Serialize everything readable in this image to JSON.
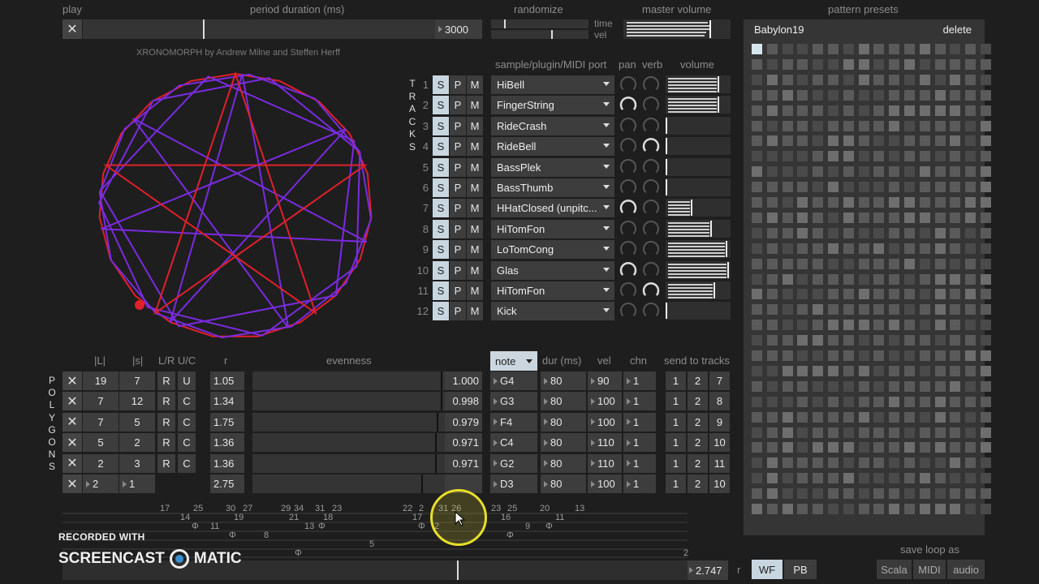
{
  "top": {
    "play_label": "play",
    "period_label": "period duration (ms)",
    "period_value": "3000",
    "period_fill": 0.34,
    "randomize_label": "randomize",
    "time_label": "time",
    "vel_label": "vel",
    "master_label": "master volume",
    "presets_label": "pattern presets"
  },
  "credit": "XRONOMORPH by Andrew Milne and Steffen Herff",
  "tracks_header": {
    "vertical": "TRACKS",
    "port": "sample/plugin/MIDI port",
    "pan": "pan",
    "verb": "verb",
    "volume": "volume"
  },
  "tracks": [
    {
      "n": "1",
      "s": "S",
      "p": "P",
      "m": "M",
      "name": "HiBell",
      "vol": 0.82
    },
    {
      "n": "2",
      "s": "S",
      "p": "P",
      "m": "M",
      "name": "FingerString",
      "vol": 0.82
    },
    {
      "n": "3",
      "s": "S",
      "p": "P",
      "m": "M",
      "name": "RideCrash",
      "vol": 0.0
    },
    {
      "n": "4",
      "s": "S",
      "p": "P",
      "m": "M",
      "name": "RideBell",
      "vol": 0.0
    },
    {
      "n": "5",
      "s": "S",
      "p": "P",
      "m": "M",
      "name": "BassPlek",
      "vol": 0.0
    },
    {
      "n": "6",
      "s": "S",
      "p": "P",
      "m": "M",
      "name": "BassThumb",
      "vol": 0.0
    },
    {
      "n": "7",
      "s": "S",
      "p": "P",
      "m": "M",
      "name": "HHatClosed (unpitc...",
      "vol": 0.4
    },
    {
      "n": "8",
      "s": "S",
      "p": "P",
      "m": "M",
      "name": "HiTomFon",
      "vol": 0.7
    },
    {
      "n": "9",
      "s": "S",
      "p": "P",
      "m": "M",
      "name": "LoTomCong",
      "vol": 0.95
    },
    {
      "n": "10",
      "s": "S",
      "p": "P",
      "m": "M",
      "name": "Glas",
      "vol": 0.98
    },
    {
      "n": "11",
      "s": "S",
      "p": "P",
      "m": "M",
      "name": "HiTomFon",
      "vol": 0.75
    },
    {
      "n": "12",
      "s": "S",
      "p": "P",
      "m": "M",
      "name": "Kick",
      "vol": 0.0
    }
  ],
  "polygons_header": {
    "vertical": "POLYGONS",
    "L": "|L|",
    "s": "|s|",
    "lr_uc": "L/R U/C",
    "r": "r",
    "evenness": "evenness",
    "note": "note",
    "dur": "dur (ms)",
    "vel": "vel",
    "chn": "chn",
    "send": "send to tracks"
  },
  "polygons": [
    {
      "L": "19",
      "s": "7",
      "lr": "R",
      "uc": "U",
      "r": "1.05",
      "even": "1.000",
      "note": "G4",
      "dur": "80",
      "vel": "90",
      "chn": "1",
      "t1": "1",
      "t2": "2",
      "t3": "7"
    },
    {
      "L": "7",
      "s": "12",
      "lr": "R",
      "uc": "C",
      "r": "1.34",
      "even": "0.998",
      "note": "G3",
      "dur": "80",
      "vel": "100",
      "chn": "1",
      "t1": "1",
      "t2": "2",
      "t3": "8"
    },
    {
      "L": "7",
      "s": "5",
      "lr": "R",
      "uc": "C",
      "r": "1.75",
      "even": "0.979",
      "note": "F4",
      "dur": "80",
      "vel": "100",
      "chn": "1",
      "t1": "1",
      "t2": "2",
      "t3": "9"
    },
    {
      "L": "5",
      "s": "2",
      "lr": "R",
      "uc": "C",
      "r": "1.36",
      "even": "0.971",
      "note": "C4",
      "dur": "80",
      "vel": "110",
      "chn": "1",
      "t1": "1",
      "t2": "2",
      "t3": "10"
    },
    {
      "L": "2",
      "s": "3",
      "lr": "R",
      "uc": "C",
      "r": "1.36",
      "even": "0.971",
      "note": "G2",
      "dur": "80",
      "vel": "110",
      "chn": "1",
      "t1": "1",
      "t2": "2",
      "t3": "11"
    },
    {
      "L": "2",
      "s": "1",
      "lr": "",
      "uc": "",
      "r": "2.75",
      "even": "",
      "note": "D3",
      "dur": "80",
      "vel": "100",
      "chn": "1",
      "t1": "1",
      "t2": "2",
      "t3": "10"
    }
  ],
  "sequence": {
    "row1": [
      [
        "17",
        197
      ],
      [
        "25",
        238
      ],
      [
        "30",
        278
      ],
      [
        "27",
        299
      ],
      [
        "29",
        346
      ],
      [
        "34",
        362
      ],
      [
        "31",
        388
      ],
      [
        "23",
        409
      ],
      [
        "22",
        496
      ],
      [
        "2",
        516
      ],
      [
        "31",
        540
      ],
      [
        "26",
        556
      ],
      [
        "23",
        605
      ],
      [
        "25",
        625
      ],
      [
        "20",
        665
      ],
      [
        "13",
        708
      ]
    ],
    "row2": [
      [
        "14",
        222
      ],
      [
        "19",
        288
      ],
      [
        "21",
        356
      ],
      [
        "18",
        398
      ],
      [
        "17",
        508
      ],
      [
        "16",
        617
      ],
      [
        "11",
        684
      ]
    ],
    "row3": [
      [
        "Φ",
        236
      ],
      [
        "11",
        259
      ],
      [
        "13",
        375
      ],
      [
        "Φ",
        392
      ],
      [
        "Φ",
        515
      ],
      [
        "2",
        535
      ],
      [
        "9",
        647
      ],
      [
        "Φ",
        672
      ]
    ],
    "row4": [
      [
        "Φ",
        282
      ],
      [
        "8",
        325
      ],
      [
        "Φ",
        624
      ]
    ],
    "row5": [
      [
        "5",
        455
      ]
    ],
    "row6": [
      [
        "Φ",
        363
      ],
      [
        "2",
        842
      ]
    ]
  },
  "bottom": {
    "r_value": "2.747",
    "r_label": "r",
    "wf": "WF",
    "pb": "PB",
    "save_label": "save loop as",
    "scala": "Scala",
    "midi": "MIDI",
    "audio": "audio",
    "preset_name": "Babylon19",
    "delete": "delete"
  },
  "watermark": {
    "line1": "RECORDED WITH",
    "line2a": "SCREENCAST",
    "line2b": "MATIC"
  },
  "colors": {
    "polygon_red": "#e0202a",
    "polygon_purple": "#7a2be0",
    "accent_blue": "#c8d6e0"
  }
}
